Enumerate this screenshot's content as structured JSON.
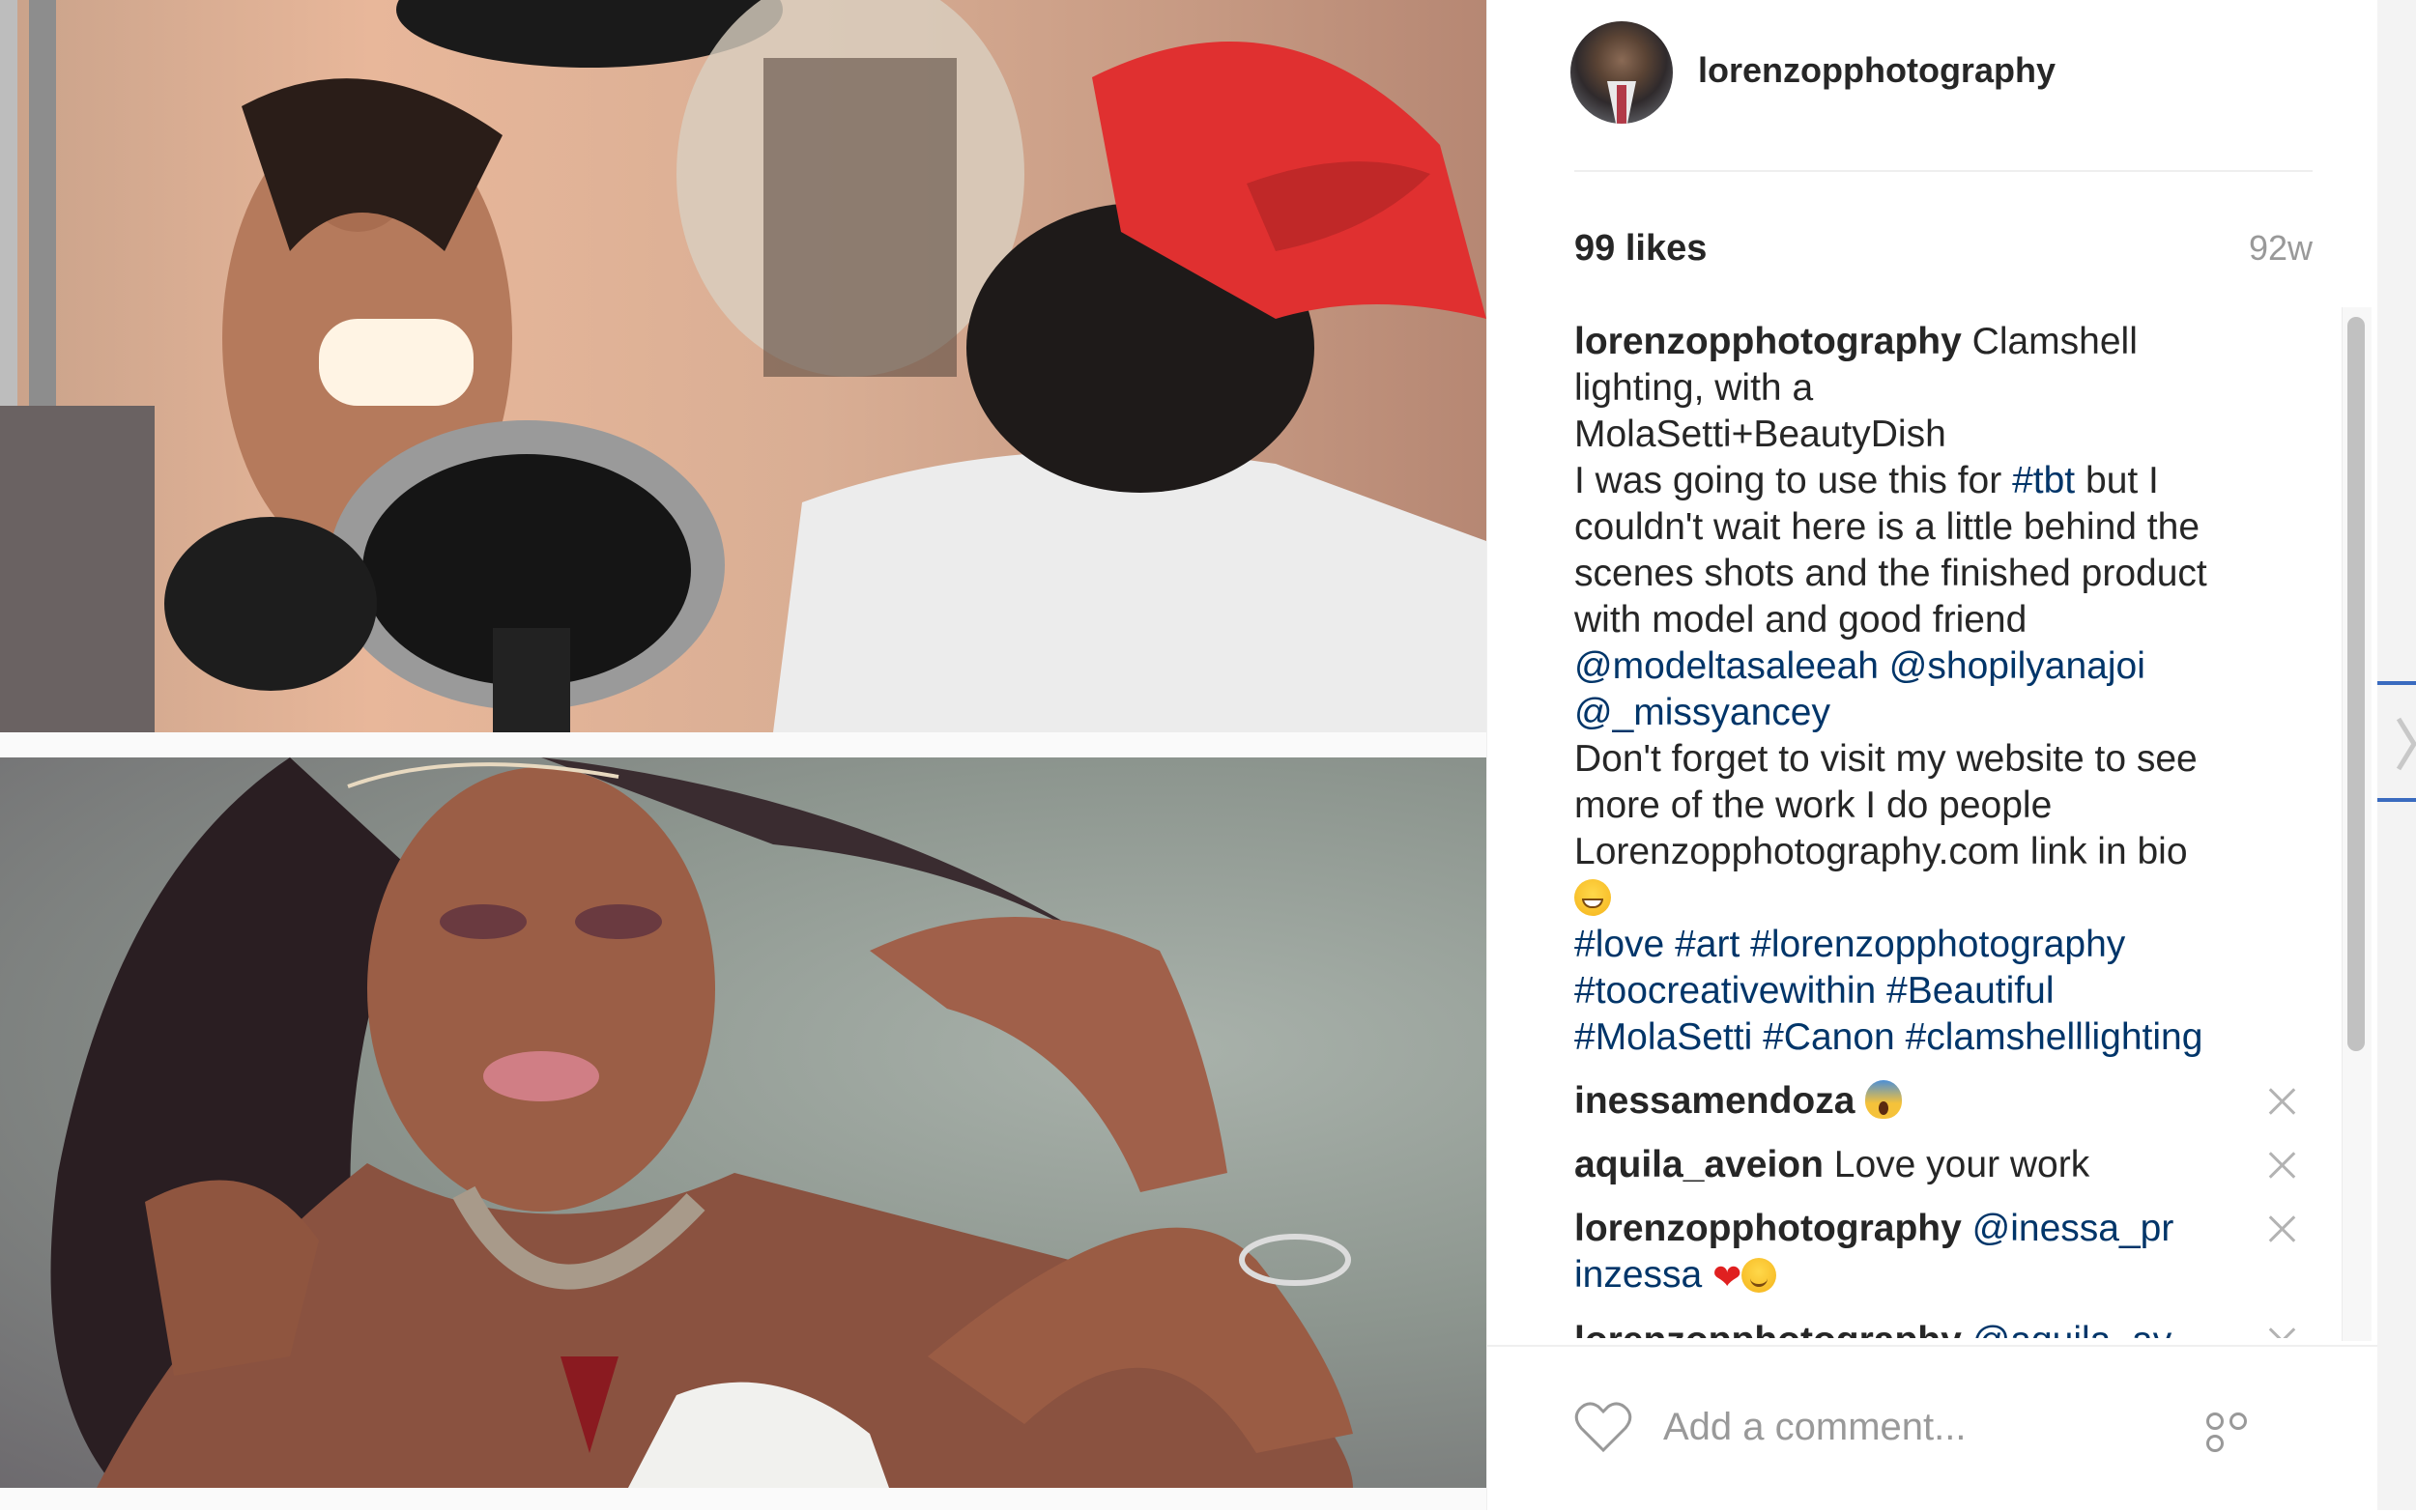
{
  "post": {
    "username": "lorenzopphotography",
    "likes": "99 likes",
    "age": "92w"
  },
  "caption": {
    "author": "lorenzopphotography",
    "text_1": "Clamshell",
    "line_2": "lighting, with a",
    "line_3": "MolaSetti+BeautyDish",
    "line_4a": "I was going to use this for",
    "tag_tbt": "#tbt",
    "line_4b": "but I",
    "line_5": "couldn't wait here is a little behind the",
    "line_6": "scenes shots and the finished product",
    "line_7": "with model and good friend",
    "mention_1": "@modeltasaleeah",
    "mention_2": "@shopilyanajoi",
    "mention_3": "@_missyancey",
    "line_9": "Don't forget to visit my website to see",
    "line_10": "more of the work I do people",
    "line_11": "Lorenzopphotography.com link in bio",
    "hashtags": [
      "#love",
      "#art",
      "#lorenzopphotography",
      "#toocreativewithin",
      "#Beautiful",
      "#MolaSetti",
      "#Canon",
      "#clamshelllighting"
    ]
  },
  "comments": [
    {
      "user": "inessamendoza",
      "text": ""
    },
    {
      "user": "aquila_aveion",
      "text": "Love your work"
    },
    {
      "user": "lorenzopphotography",
      "mention": "@inessa_pr",
      "mention_cont": "inzessa"
    },
    {
      "user": "lorenzopphotography",
      "mention": "@aquila_av"
    }
  ],
  "footer": {
    "comment_placeholder": "Add a comment..."
  },
  "icons": {
    "like": "heart-icon",
    "more": "more-options-icon",
    "remove": "close-icon",
    "next": "chevron-right-icon"
  },
  "colors": {
    "link": "#003569",
    "muted": "#999999",
    "text": "#262626"
  }
}
